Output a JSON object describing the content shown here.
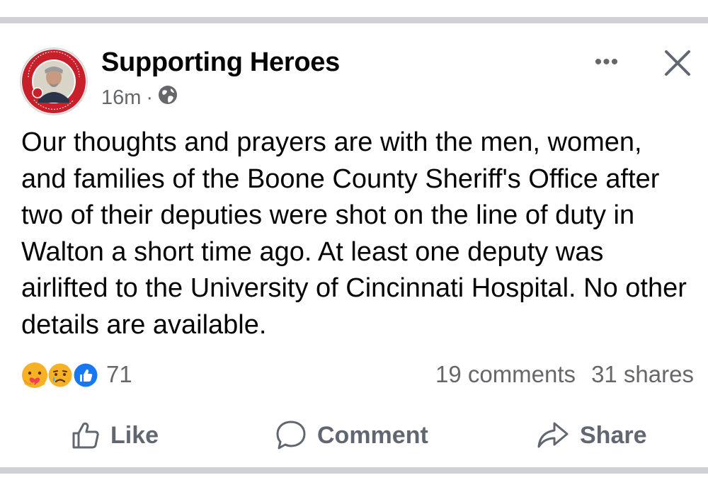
{
  "post": {
    "author": "Supporting Heroes",
    "time": "16m",
    "separator": "·",
    "privacy_icon": "globe-icon",
    "avatar": {
      "ring_text_top": "LIEUTENANT BRIAN HATT",
      "ring_text_bottom": "LAST CALL",
      "date": "08-25-2025",
      "ring_color": "#c8202b"
    },
    "more_icon": "ellipsis-icon",
    "more_label": "•••",
    "close_icon": "close-icon",
    "text": "Our thoughts and prayers are with the men, women, and families of the Boone County Sheriff's Office after two of their deputies were shot on the line of duty in Walton a short time ago. At least one deputy was airlifted to the University of Cincinnati Hospital. No other details are available."
  },
  "reactions": {
    "icons": [
      "care-reaction-icon",
      "sad-reaction-icon",
      "like-reaction-icon"
    ],
    "count": "71",
    "comments": "19 comments",
    "shares": "31 shares"
  },
  "actions": {
    "like": "Like",
    "comment": "Comment",
    "share": "Share"
  },
  "colors": {
    "text": "#050505",
    "secondary_text": "#65676b",
    "like_blue": "#1877f2",
    "reaction_yellow": "#f7b125",
    "divider": "#cfd1d5"
  }
}
